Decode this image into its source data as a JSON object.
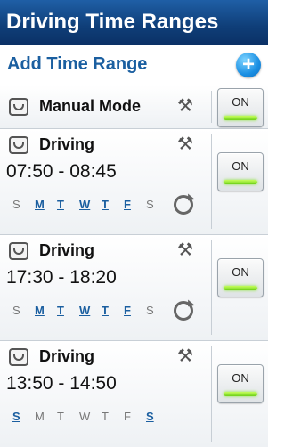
{
  "header": {
    "title": "Driving Time Ranges"
  },
  "add_row": {
    "label": "Add Time Range",
    "icon": "plus-circle-icon"
  },
  "manual_mode": {
    "label": "Manual Mode",
    "toggle": "ON",
    "icon": "driving-mode-icon"
  },
  "ranges": [
    {
      "title": "Driving",
      "time": "07:50 - 08:45",
      "toggle": "ON",
      "repeat": true,
      "days": [
        {
          "d": "S",
          "active": false
        },
        {
          "d": "M",
          "active": true
        },
        {
          "d": "T",
          "active": true
        },
        {
          "d": "W",
          "active": true
        },
        {
          "d": "T",
          "active": true
        },
        {
          "d": "F",
          "active": true
        },
        {
          "d": "S",
          "active": false
        }
      ]
    },
    {
      "title": "Driving",
      "time": "17:30 - 18:20",
      "toggle": "ON",
      "repeat": true,
      "days": [
        {
          "d": "S",
          "active": false
        },
        {
          "d": "M",
          "active": true
        },
        {
          "d": "T",
          "active": true
        },
        {
          "d": "W",
          "active": true
        },
        {
          "d": "T",
          "active": true
        },
        {
          "d": "F",
          "active": true
        },
        {
          "d": "S",
          "active": false
        }
      ]
    },
    {
      "title": "Driving",
      "time": "13:50 - 14:50",
      "toggle": "ON",
      "repeat": false,
      "days": [
        {
          "d": "S",
          "active": true
        },
        {
          "d": "M",
          "active": false
        },
        {
          "d": "T",
          "active": false
        },
        {
          "d": "W",
          "active": false
        },
        {
          "d": "T",
          "active": false
        },
        {
          "d": "F",
          "active": false
        },
        {
          "d": "S",
          "active": true
        }
      ]
    }
  ],
  "colors": {
    "header": "#0f3e78",
    "accent": "#1b5fa0",
    "on_bar": "#7ed321"
  }
}
